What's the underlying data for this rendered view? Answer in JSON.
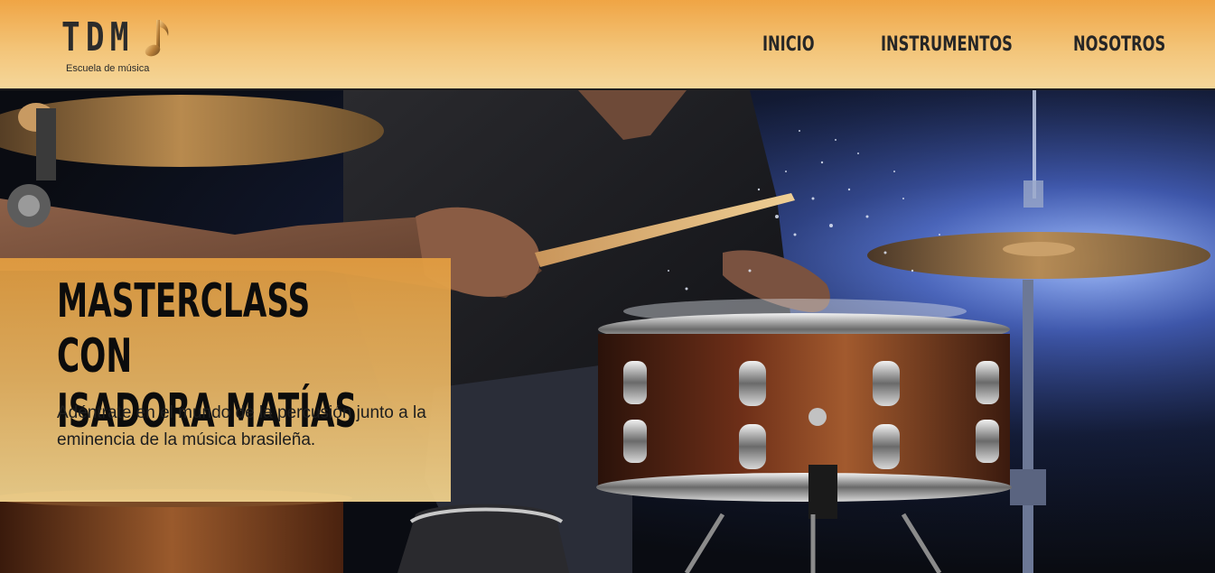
{
  "header": {
    "logo": {
      "text": "TDM",
      "subtitle": "Escuela de música"
    },
    "nav": {
      "items": [
        {
          "label": "INICIO"
        },
        {
          "label": "INSTRUMENTOS"
        },
        {
          "label": "NOSOTROS"
        }
      ]
    }
  },
  "hero": {
    "image_subject": "drummer-snare-photo",
    "promo": {
      "title_line1": "MASTERCLASS CON",
      "title_line2": "ISADORA MATÍAS",
      "description": "Adéntrate en el mundo de la percusión junto a la eminencia de la música brasileña."
    }
  },
  "colors": {
    "header_top": "#f0a545",
    "header_bottom": "#f5d79a",
    "promo_top": "#e49e40",
    "promo_bottom": "#eed08c",
    "text_dark": "#262626"
  },
  "icons": {
    "logo_note": "music-note-icon"
  }
}
